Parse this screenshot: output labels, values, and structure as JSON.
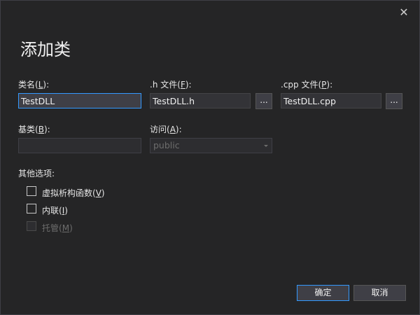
{
  "dialog": {
    "title": "添加类",
    "close_glyph": "✕"
  },
  "fields": {
    "class_name": {
      "label": "类名",
      "accel": "L",
      "value": "TestDLL"
    },
    "h_file": {
      "label": ".h 文件",
      "accel": "F",
      "value": "TestDLL.h",
      "browse_label": "..."
    },
    "cpp_file": {
      "label": ".cpp 文件",
      "accel": "P",
      "value": "TestDLL.cpp",
      "browse_label": "..."
    },
    "base_class": {
      "label": "基类",
      "accel": "B",
      "value": ""
    },
    "access": {
      "label": "访问",
      "accel": "A",
      "value": "public"
    }
  },
  "options": {
    "heading": "其他选项:",
    "virtual_destructor": {
      "label": "虚拟析构函数",
      "accel": "V",
      "checked": false
    },
    "inline": {
      "label": "内联",
      "accel": "I",
      "checked": false
    },
    "managed": {
      "label": "托管",
      "accel": "M",
      "checked": false,
      "disabled": true
    }
  },
  "buttons": {
    "ok_label": "确定",
    "cancel_label": "取消"
  },
  "colors": {
    "background": "#252526",
    "accent": "#3399ff",
    "text": "#f1f1f1",
    "disabled_text": "#6d6d6d"
  }
}
